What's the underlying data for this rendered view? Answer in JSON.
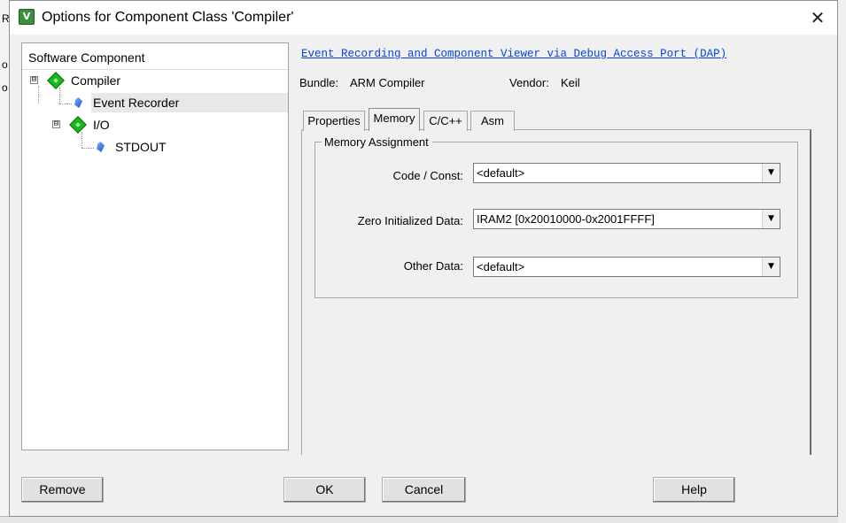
{
  "window": {
    "title": "Options for Component Class 'Compiler'",
    "close_glyph": "✕",
    "icon_glyph": "V"
  },
  "background": {
    "edge_letters": [
      "R",
      "o",
      "o"
    ]
  },
  "tree": {
    "header": "Software Component",
    "items": [
      {
        "label": "Compiler",
        "icon": "green-diamond-icon",
        "expander": "⊟"
      },
      {
        "label": "Event Recorder",
        "icon": "blue-gem-icon",
        "selected": true
      },
      {
        "label": "I/O",
        "icon": "green-diamond-icon",
        "expander": "⊟"
      },
      {
        "label": "STDOUT",
        "icon": "blue-gem-icon"
      }
    ]
  },
  "details": {
    "link": "Event Recording and Component Viewer via Debug Access Port (DAP)",
    "bundle_label": "Bundle:",
    "bundle_value": "ARM Compiler",
    "vendor_label": "Vendor:",
    "vendor_value": "Keil"
  },
  "tabs": [
    {
      "label": "Properties"
    },
    {
      "label": "Memory",
      "active": true
    },
    {
      "label": "C/C++"
    },
    {
      "label": "Asm"
    }
  ],
  "memory": {
    "group_title": "Memory Assignment",
    "fields": [
      {
        "label": "Code / Const:",
        "value": "<default>"
      },
      {
        "label": "Zero Initialized Data:",
        "value": "IRAM2 [0x20010000-0x2001FFFF]"
      },
      {
        "label": "Other Data:",
        "value": "<default>"
      }
    ],
    "dropdown_glyph": "▼"
  },
  "buttons": {
    "remove": "Remove",
    "ok": "OK",
    "cancel": "Cancel",
    "help": "Help"
  }
}
